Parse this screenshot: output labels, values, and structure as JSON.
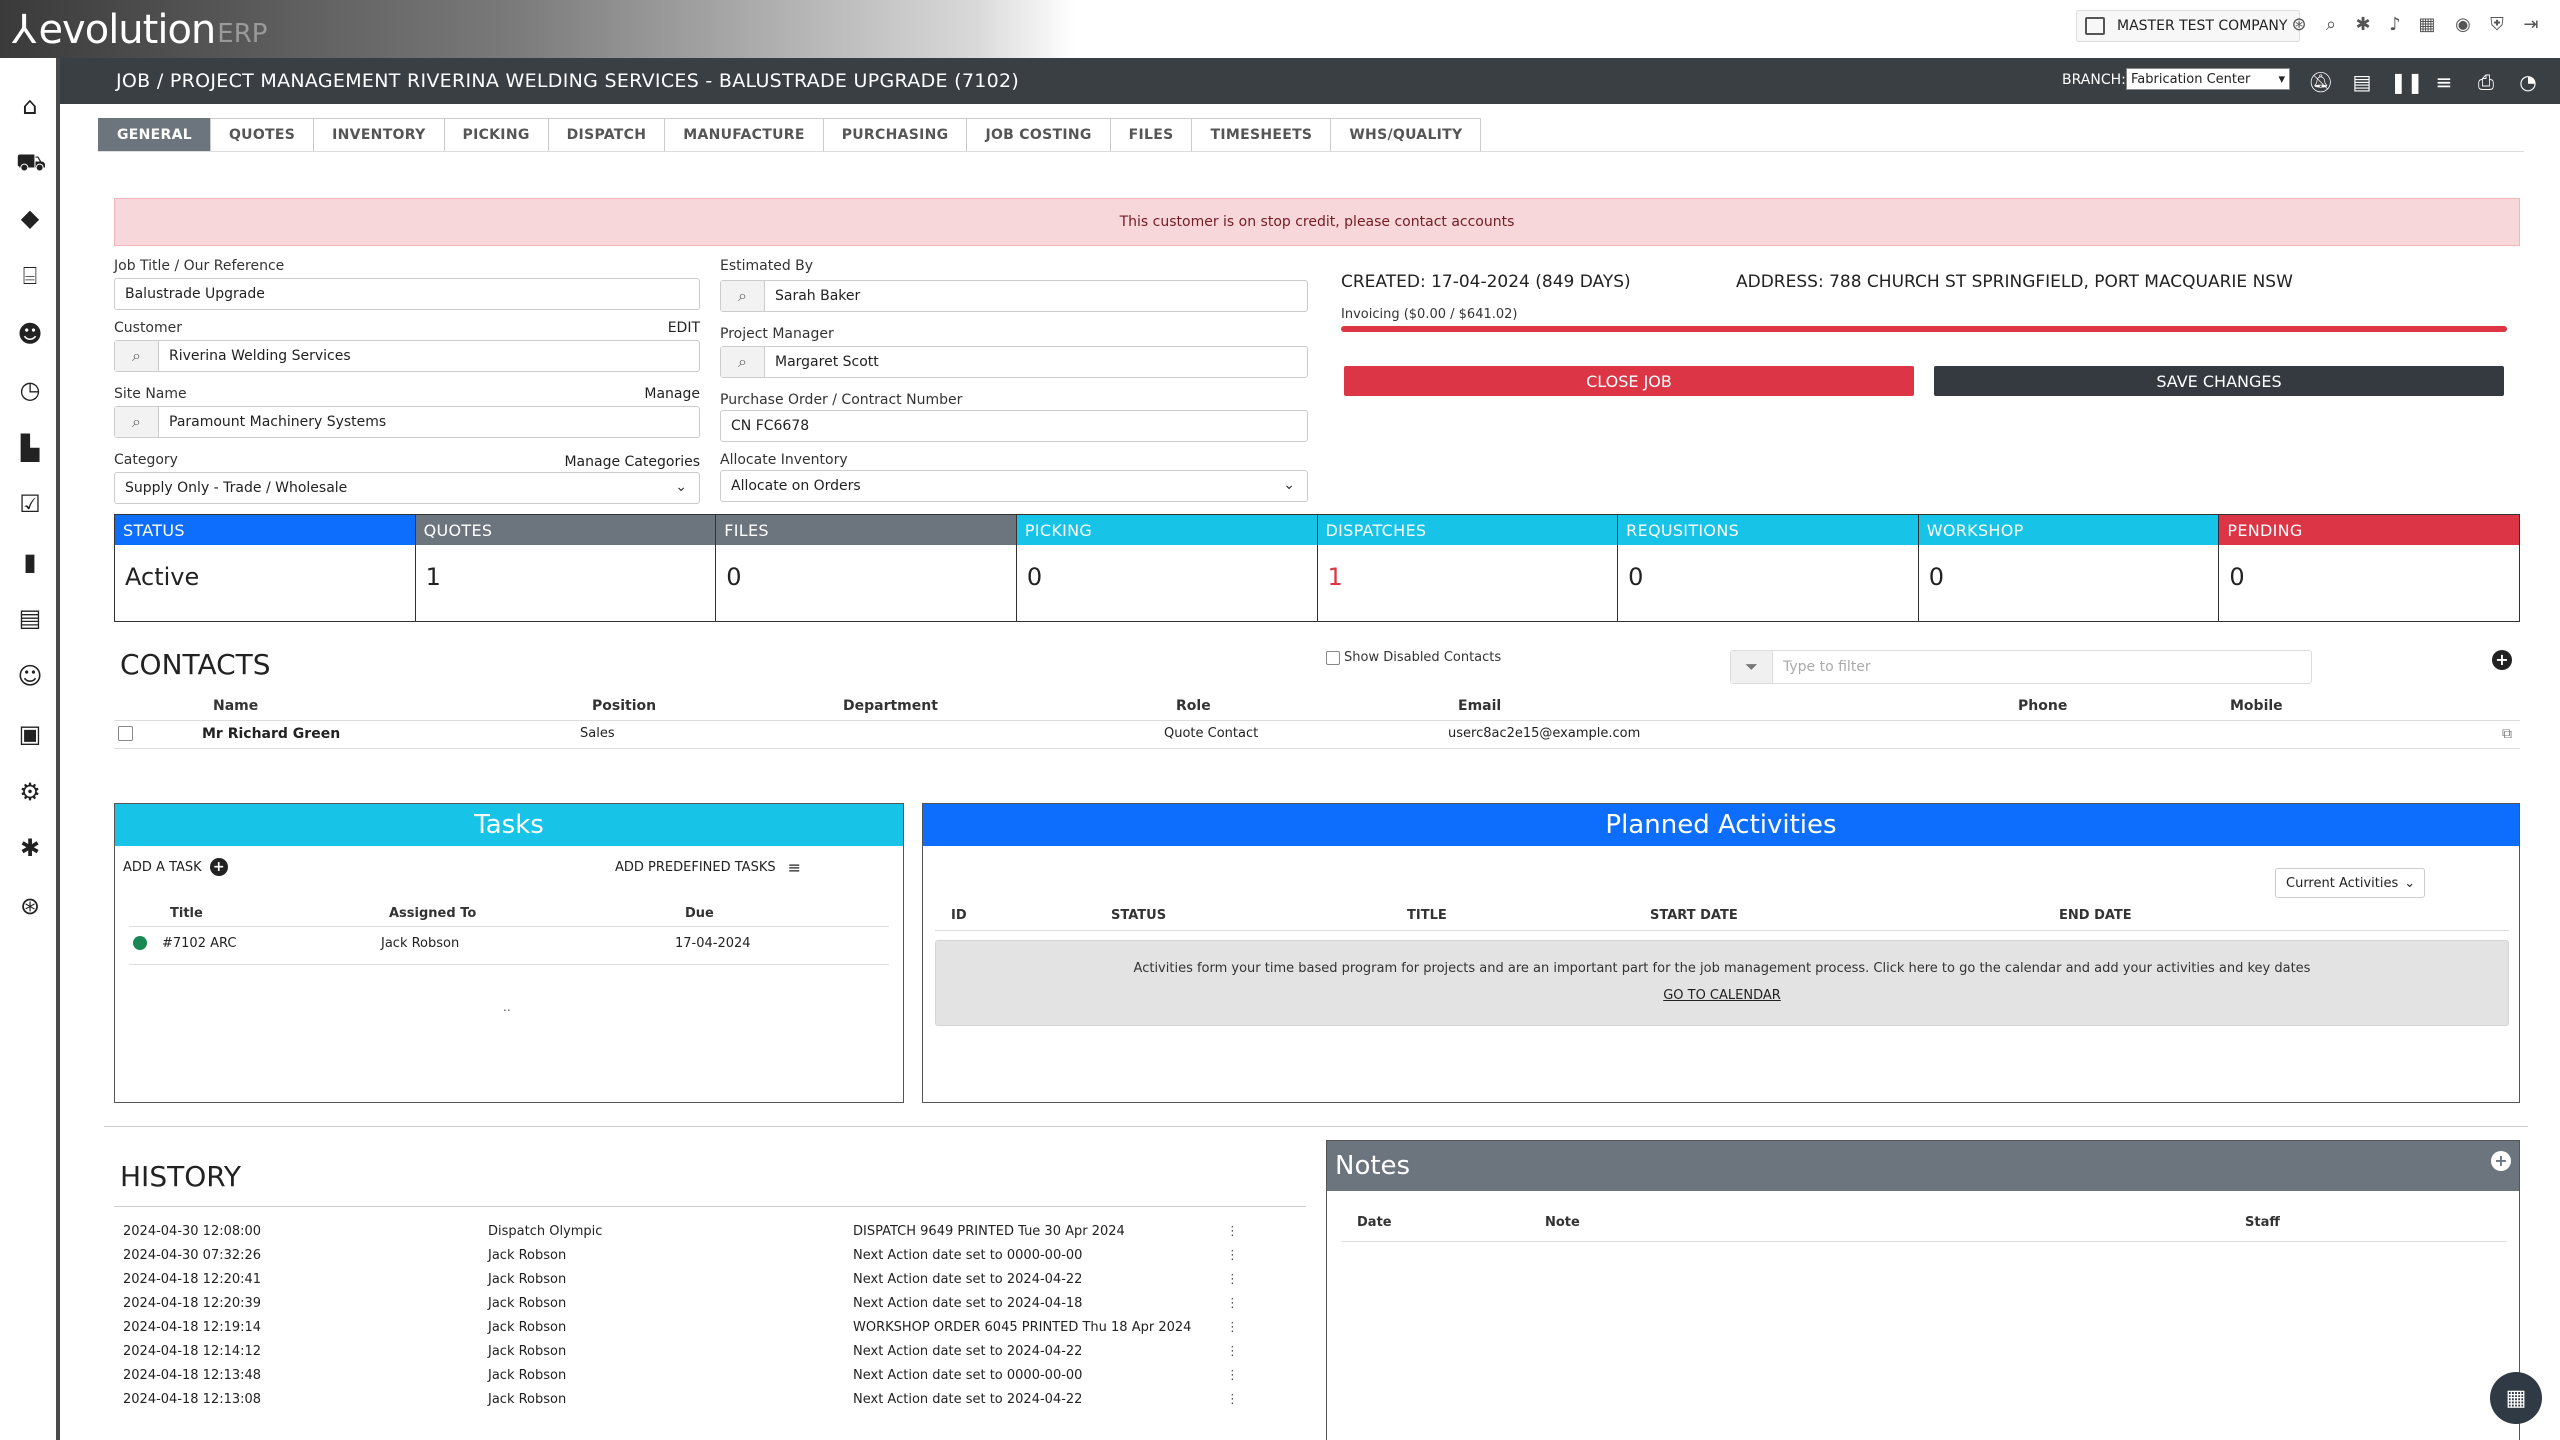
{
  "app": {
    "logo_text": "evolution",
    "logo_suffix": "ERP",
    "company": "MASTER TEST COMPANY"
  },
  "titlebar": {
    "title": "JOB / PROJECT MANAGEMENT RIVERINA WELDING SERVICES - BALUSTRADE UPGRADE (7102)",
    "branch_label": "BRANCH:",
    "branch_value": "Fabrication Center"
  },
  "tabs": [
    "GENERAL",
    "QUOTES",
    "INVENTORY",
    "PICKING",
    "DISPATCH",
    "MANUFACTURE",
    "PURCHASING",
    "JOB COSTING",
    "FILES",
    "TIMESHEETS",
    "WHS/QUALITY"
  ],
  "alert": "This customer is on stop credit, please contact accounts",
  "form": {
    "job_title_label": "Job Title / Our Reference",
    "job_title": "Balustrade Upgrade",
    "customer_label": "Customer",
    "customer_edit": "EDIT",
    "customer": "Riverina Welding Services",
    "site_label": "Site Name",
    "site_manage": "Manage",
    "site": "Paramount Machinery Systems",
    "category_label": "Category",
    "category_manage": "Manage Categories",
    "category": "Supply Only - Trade / Wholesale",
    "estimated_label": "Estimated By",
    "estimated": "Sarah Baker",
    "pm_label": "Project Manager",
    "pm": "Margaret Scott",
    "po_label": "Purchase Order / Contract Number",
    "po": "CN FC6678",
    "alloc_label": "Allocate Inventory",
    "alloc": "Allocate on Orders"
  },
  "summary": {
    "created": "CREATED: 17-04-2024 (849 DAYS)",
    "address": "ADDRESS: 788 CHURCH ST SPRINGFIELD, PORT MACQUARIE NSW",
    "invoicing": "Invoicing ($0.00 / $641.02)",
    "invoiced_fraction": 0,
    "close_job": "CLOSE JOB",
    "save_changes": "SAVE CHANGES"
  },
  "stats": [
    {
      "label": "STATUS",
      "value": "Active",
      "color": "#0d6efd",
      "value_color": "#222"
    },
    {
      "label": "QUOTES",
      "value": "1",
      "color": "#6c757d",
      "value_color": "#222"
    },
    {
      "label": "FILES",
      "value": "0",
      "color": "#6c757d",
      "value_color": "#222"
    },
    {
      "label": "PICKING",
      "value": "0",
      "color": "#17c4e8",
      "value_color": "#222"
    },
    {
      "label": "DISPATCHES",
      "value": "1",
      "color": "#17c4e8",
      "value_color": "#dc3545"
    },
    {
      "label": "REQUSITIONS",
      "value": "0",
      "color": "#17c4e8",
      "value_color": "#222"
    },
    {
      "label": "WORKSHOP",
      "value": "0",
      "color": "#17c4e8",
      "value_color": "#222"
    },
    {
      "label": "PENDING",
      "value": "0",
      "color": "#dc3545",
      "value_color": "#222"
    }
  ],
  "contacts": {
    "title": "CONTACTS",
    "show_disabled": "Show Disabled Contacts",
    "filter_placeholder": "Type to filter",
    "columns": [
      "Name",
      "Position",
      "Department",
      "Role",
      "Email",
      "Phone",
      "Mobile"
    ],
    "rows": [
      {
        "name": "Mr Richard Green",
        "position": "Sales",
        "department": "",
        "role": "Quote Contact",
        "email": "userc8ac2e15@example.com",
        "phone": "",
        "mobile": ""
      }
    ]
  },
  "tasks": {
    "title": "Tasks",
    "add_task": "ADD A TASK",
    "add_predefined": "ADD PREDEFINED TASKS",
    "columns": [
      "Title",
      "Assigned To",
      "Due"
    ],
    "rows": [
      {
        "title": "#7102 ARC",
        "assigned": "Jack Robson",
        "due": "17-04-2024"
      }
    ],
    "footer": ".."
  },
  "planned": {
    "title": "Planned Activities",
    "filter": "Current Activities",
    "columns": [
      "ID",
      "STATUS",
      "TITLE",
      "START DATE",
      "END DATE"
    ],
    "info": "Activities form your time based program for projects and are an important part for the job management process. Click here to go the calendar and add your activities and key dates",
    "go_calendar": "GO TO CALENDAR"
  },
  "history": {
    "title": "HISTORY",
    "rows": [
      {
        "date": "2024-04-30 12:08:00",
        "user": "Dispatch Olympic",
        "action": "DISPATCH 9649 PRINTED Tue 30 Apr 2024"
      },
      {
        "date": "2024-04-30 07:32:26",
        "user": "Jack Robson",
        "action": "Next Action date set to 0000-00-00"
      },
      {
        "date": "2024-04-18 12:20:41",
        "user": "Jack Robson",
        "action": "Next Action date set to 2024-04-22"
      },
      {
        "date": "2024-04-18 12:20:39",
        "user": "Jack Robson",
        "action": "Next Action date set to 2024-04-18"
      },
      {
        "date": "2024-04-18 12:19:14",
        "user": "Jack Robson",
        "action": "WORKSHOP ORDER 6045 PRINTED Thu 18 Apr 2024"
      },
      {
        "date": "2024-04-18 12:14:12",
        "user": "Jack Robson",
        "action": "Next Action date set to 2024-04-22"
      },
      {
        "date": "2024-04-18 12:13:48",
        "user": "Jack Robson",
        "action": "Next Action date set to 0000-00-00"
      },
      {
        "date": "2024-04-18 12:13:08",
        "user": "Jack Robson",
        "action": "Next Action date set to 2024-04-22"
      }
    ]
  },
  "notes": {
    "title": "Notes",
    "columns": [
      "Date",
      "Note",
      "Staff"
    ]
  },
  "icons": {
    "sidebar": [
      "home-icon",
      "cart-icon",
      "tag-icon",
      "bank-icon",
      "user-settings-icon",
      "clock-icon",
      "factory-icon",
      "clipboard-check-icon",
      "chart-icon",
      "building-icon",
      "users-icon",
      "id-card-icon",
      "gear-icon",
      "puzzle-icon",
      "lifebuoy-icon"
    ],
    "topbar": [
      "lifebuoy-icon",
      "search-icon",
      "puzzle-icon",
      "bell-icon",
      "calendar-icon",
      "user-circle-icon",
      "shield-icon",
      "logout-icon"
    ],
    "titlebar": [
      "bell-slash-icon",
      "clipboard-icon",
      "pause-icon",
      "list-icon",
      "print-icon",
      "timer-icon"
    ]
  }
}
